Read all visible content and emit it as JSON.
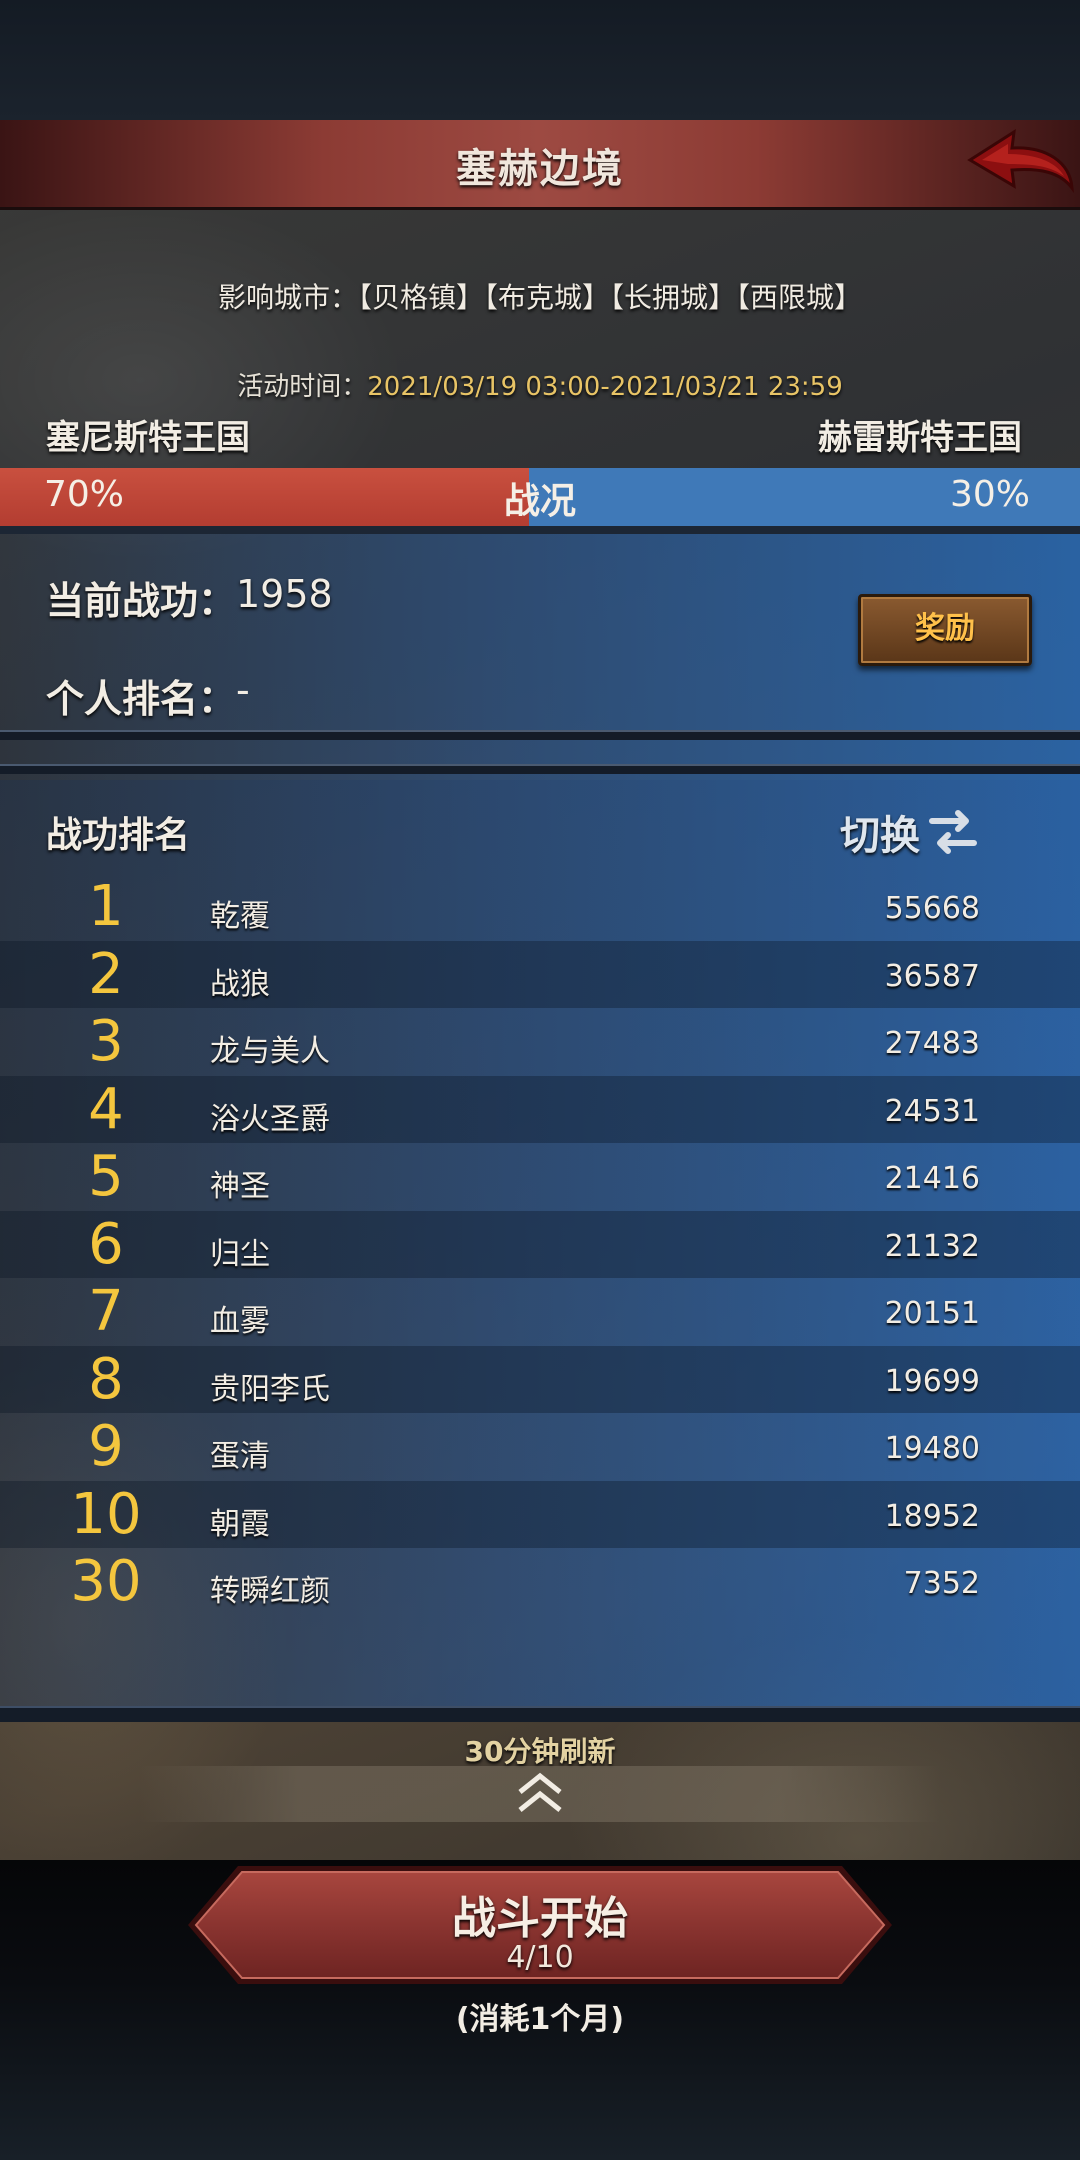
{
  "header": {
    "title": "塞赫边境"
  },
  "info": {
    "influence_cities": "影响城市：【贝格镇】【布克城】【长拥城】【西限城】",
    "activity_time_label": "活动时间：",
    "activity_time_value": "2021/03/19 03:00-2021/03/21 23:59"
  },
  "war": {
    "left_kingdom": "塞尼斯特王国",
    "right_kingdom": "赫雷斯特王国",
    "left_percent_text": "70%",
    "right_percent_text": "30%",
    "left_share": 0.7,
    "status_label": "战况",
    "left_color": "#c0483a",
    "right_color": "#3f79b8"
  },
  "personal": {
    "merit_label": "当前战功：",
    "merit_value": "1958",
    "rank_label": "个人排名：",
    "rank_value": "-",
    "reward_button": "奖励"
  },
  "ranking": {
    "title": "战功排名",
    "switch_label": "切换",
    "rows": [
      {
        "rank": "1",
        "name": "乾覆",
        "score": "55668"
      },
      {
        "rank": "2",
        "name": "战狼",
        "score": "36587"
      },
      {
        "rank": "3",
        "name": "龙与美人",
        "score": "27483"
      },
      {
        "rank": "4",
        "name": "浴火圣爵",
        "score": "24531"
      },
      {
        "rank": "5",
        "name": "神圣",
        "score": "21416"
      },
      {
        "rank": "6",
        "name": "归尘",
        "score": "21132"
      },
      {
        "rank": "7",
        "name": "血雾",
        "score": "20151"
      },
      {
        "rank": "8",
        "name": "贵阳李氏",
        "score": "19699"
      },
      {
        "rank": "9",
        "name": "蛋清",
        "score": "19480"
      },
      {
        "rank": "10",
        "name": "朝霞",
        "score": "18952"
      },
      {
        "rank": "30",
        "name": "转瞬红颜",
        "score": "7352"
      }
    ]
  },
  "footer": {
    "refresh_note": "30分钟刷新",
    "battle_label": "战斗开始",
    "battle_count": "4/10",
    "battle_cost": "(消耗1个月)"
  },
  "icons": {
    "back": "back-arrow-icon",
    "switch": "swap-arrows-icon",
    "expand": "double-chevron-up-icon"
  },
  "colors": {
    "accent_gold": "#f4c63e",
    "header_red": "#9d4a42",
    "time_gold": "#e8c466"
  }
}
